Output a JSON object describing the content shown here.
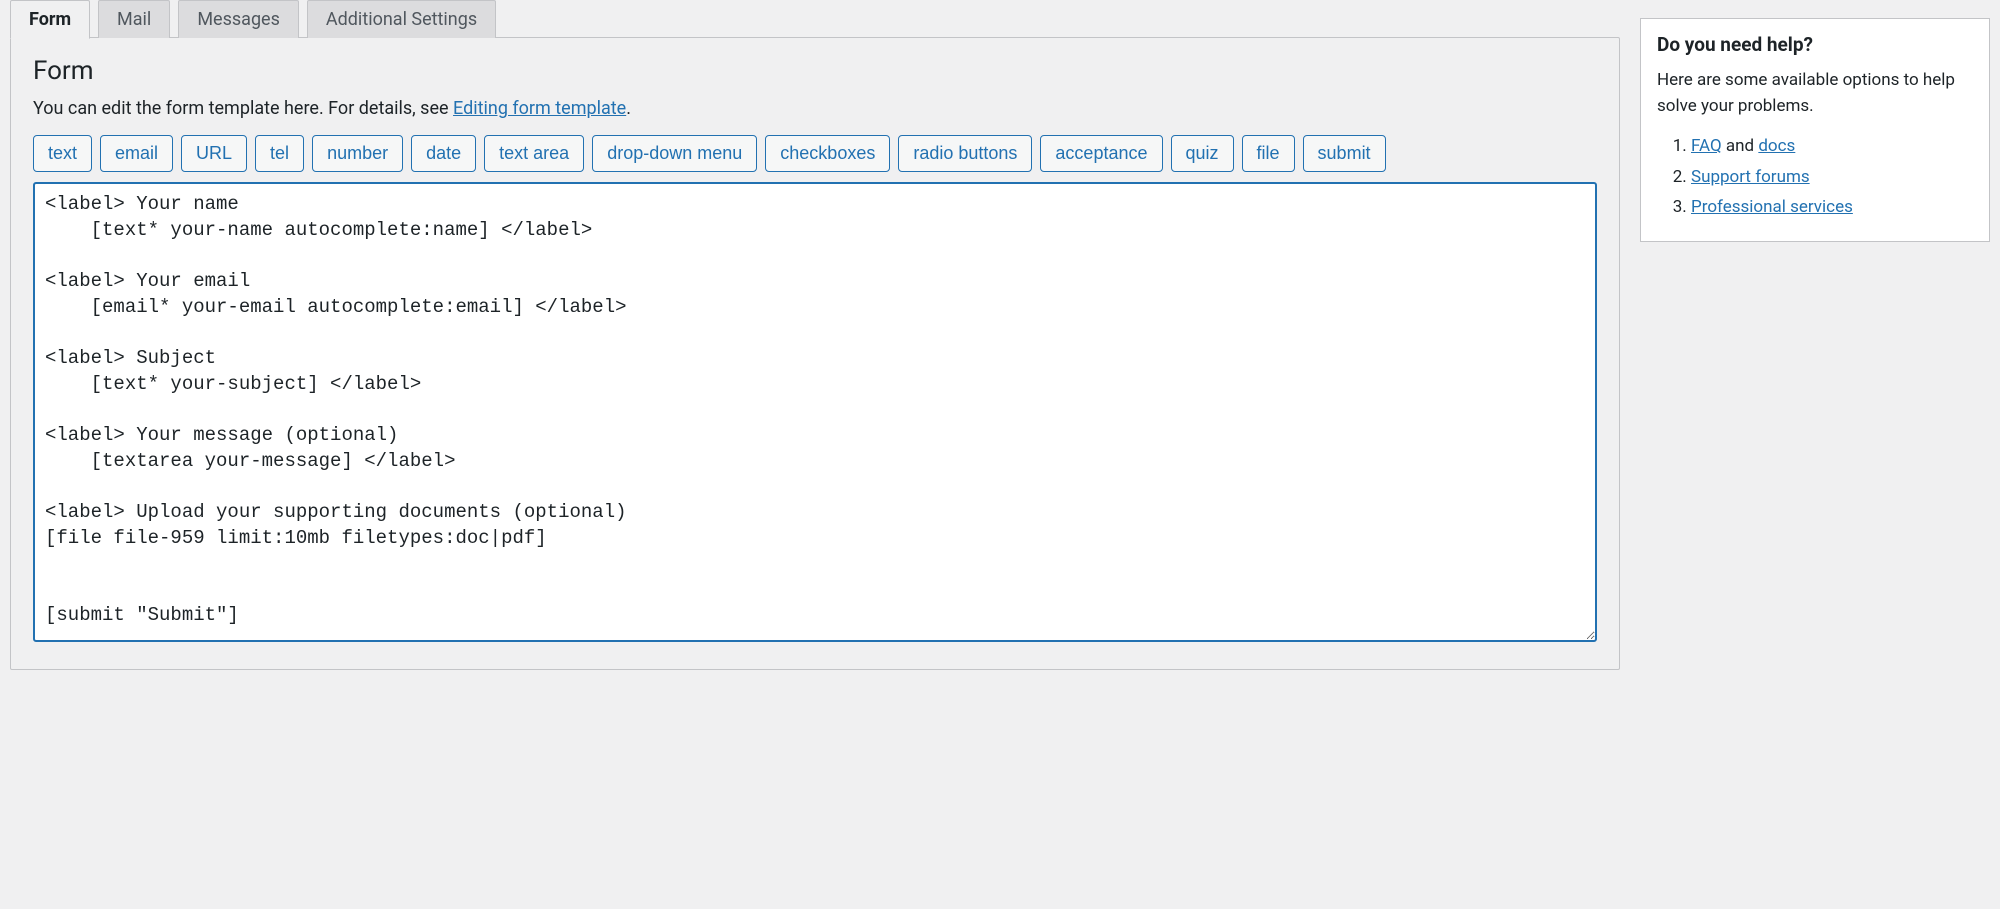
{
  "tabs": [
    {
      "label": "Form",
      "active": true
    },
    {
      "label": "Mail",
      "active": false
    },
    {
      "label": "Messages",
      "active": false
    },
    {
      "label": "Additional Settings",
      "active": false
    }
  ],
  "form": {
    "heading": "Form",
    "desc_prefix": "You can edit the form template here. For details, see ",
    "desc_link": "Editing form template",
    "desc_suffix": ".",
    "tag_buttons": [
      "text",
      "email",
      "URL",
      "tel",
      "number",
      "date",
      "text area",
      "drop-down menu",
      "checkboxes",
      "radio buttons",
      "acceptance",
      "quiz",
      "file",
      "submit"
    ],
    "template": "<label> Your name\n    [text* your-name autocomplete:name] </label>\n\n<label> Your email\n    [email* your-email autocomplete:email] </label>\n\n<label> Subject\n    [text* your-subject] </label>\n\n<label> Your message (optional)\n    [textarea your-message] </label>\n\n<label> Upload your supporting documents (optional)\n[file file-959 limit:10mb filetypes:doc|pdf]\n\n\n[submit \"Submit\"]"
  },
  "help": {
    "title": "Do you need help?",
    "intro": "Here are some available options to help solve your problems.",
    "item1_link1": "FAQ",
    "item1_and": " and ",
    "item1_link2": "docs",
    "item2": "Support forums",
    "item3": "Professional services"
  }
}
